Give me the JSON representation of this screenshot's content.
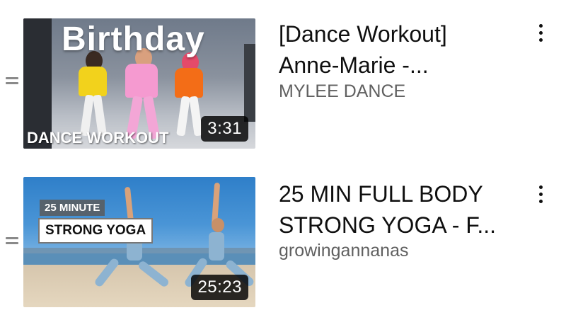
{
  "videos": [
    {
      "title_line1": "[Dance Workout]",
      "title_line2": "Anne-Marie -...",
      "channel": "MYLEE DANCE",
      "duration": "3:31",
      "thumbnail_title": "Birthday",
      "thumbnail_caption": "DANCE WORKOUT"
    },
    {
      "title_line1": "25 MIN FULL BODY",
      "title_line2": "STRONG YOGA - F...",
      "channel": "growingannanas",
      "duration": "25:23",
      "thumbnail_tag1": "25 MINUTE",
      "thumbnail_tag2": "STRONG YOGA"
    }
  ],
  "icons": {
    "drag_handle": "drag-handle-icon",
    "more_menu": "more-vert-icon"
  }
}
